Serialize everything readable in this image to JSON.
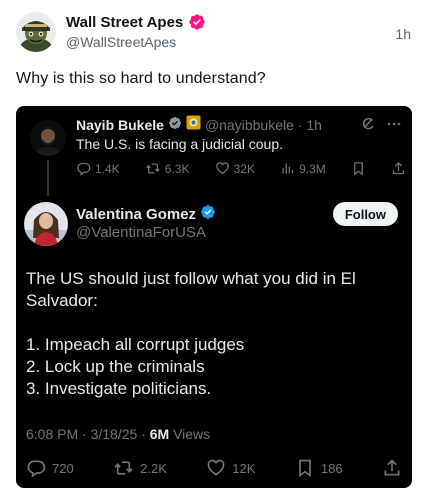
{
  "outer": {
    "display_name": "Wall Street Apes",
    "handle": "@WallStreetApes",
    "time": "1h",
    "text": "Why is this so hard to understand?",
    "verified_color": "#f91880"
  },
  "quote1": {
    "display_name": "Nayib Bukele",
    "handle_time": "@nayibbukele · 1h",
    "text": "The U.S. is facing a judicial coup.",
    "stats": {
      "replies": "1.4K",
      "reposts": "6.3K",
      "likes": "32K",
      "views": "9.3M"
    }
  },
  "quote2": {
    "display_name": "Valentina Gomez",
    "handle": "@ValentinaForUSA",
    "follow_label": "Follow",
    "body": {
      "line1": "The US should just follow what you did in El Salvador:",
      "item1": "1. Impeach all corrupt judges",
      "item2": "2. Lock up the criminals",
      "item3": "3. Investigate politicians."
    },
    "meta": {
      "datetime": "6:08 PM · 3/18/25 · ",
      "views_count": "6M",
      "views_label": " Views"
    },
    "stats": {
      "replies": "720",
      "reposts": "2.2K",
      "likes": "12K",
      "bookmarks": "186"
    }
  },
  "colors": {
    "accent_blue": "#1d9bf0",
    "dark_bg": "#000000",
    "muted": "#71767b",
    "gold_badge": "#d6a100"
  },
  "icons": [
    "verified-badge-icon",
    "reply-icon",
    "repost-icon",
    "like-icon",
    "views-icon",
    "bookmark-icon",
    "share-icon",
    "grok-icon",
    "more-icon"
  ]
}
